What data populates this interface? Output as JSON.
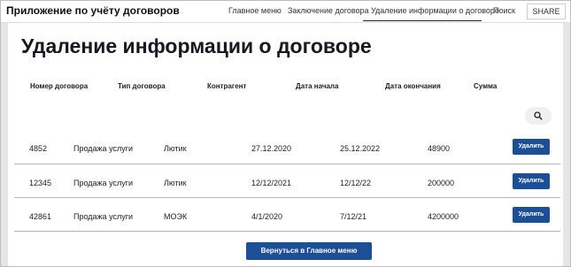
{
  "app": {
    "title": "Приложение по учёту договоров"
  },
  "nav": {
    "items": [
      {
        "label": "Главное меню"
      },
      {
        "label": "Заключение договора"
      },
      {
        "label": "Удаление информации о договоре"
      },
      {
        "label": "Поиск"
      }
    ],
    "share_label": "SHARE"
  },
  "page": {
    "title": "Удаление информации о договоре"
  },
  "table": {
    "columns": [
      "Номер договора",
      "Тип договора",
      "Контрагент",
      "Дата начала",
      "Дата окончания",
      "Сумма"
    ],
    "rows": [
      {
        "number": "4852",
        "type": "Продажа услуги",
        "counterparty": "Лютик",
        "start": "27.12.2020",
        "end": "25.12.2022",
        "amount": "48900"
      },
      {
        "number": "12345",
        "type": "Продажа услуги",
        "counterparty": "Лютик",
        "start": "12/12/2021",
        "end": "12/12/22",
        "amount": "200000"
      },
      {
        "number": "42861",
        "type": "Продажа услуги",
        "counterparty": "МОЭК",
        "start": "4/1/2020",
        "end": "7/12/21",
        "amount": "4200000"
      }
    ],
    "delete_label": "Удалить"
  },
  "footer": {
    "back_label": "Вернуться в Главное меню"
  },
  "colors": {
    "accent": "#1c4f96"
  },
  "icons": {
    "search": "search-icon"
  }
}
